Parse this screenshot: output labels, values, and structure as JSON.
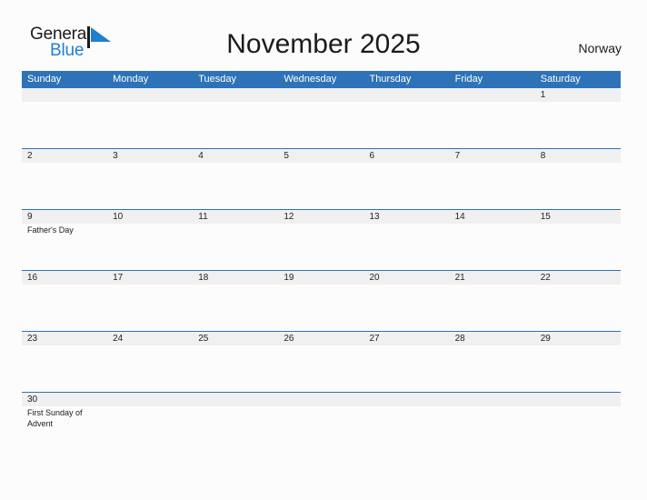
{
  "brand": {
    "name_part1": "General",
    "name_part2": "Blue",
    "logo_icon": "sail-triangle-icon",
    "accent_color": "#1f7fd0"
  },
  "header": {
    "title": "November 2025",
    "country": "Norway"
  },
  "theme": {
    "header_blue": "#2e72b8",
    "band_gray": "#f0f0f0",
    "page_background": "#fcfcfd",
    "text_color": "#1b1b1b"
  },
  "calendar": {
    "month": "November",
    "year": "2025",
    "weekday_headers": [
      "Sunday",
      "Monday",
      "Tuesday",
      "Wednesday",
      "Thursday",
      "Friday",
      "Saturday"
    ],
    "weeks": [
      {
        "days": [
          {
            "num": "",
            "events": []
          },
          {
            "num": "",
            "events": []
          },
          {
            "num": "",
            "events": []
          },
          {
            "num": "",
            "events": []
          },
          {
            "num": "",
            "events": []
          },
          {
            "num": "",
            "events": []
          },
          {
            "num": "1",
            "events": []
          }
        ]
      },
      {
        "days": [
          {
            "num": "2",
            "events": []
          },
          {
            "num": "3",
            "events": []
          },
          {
            "num": "4",
            "events": []
          },
          {
            "num": "5",
            "events": []
          },
          {
            "num": "6",
            "events": []
          },
          {
            "num": "7",
            "events": []
          },
          {
            "num": "8",
            "events": []
          }
        ]
      },
      {
        "days": [
          {
            "num": "9",
            "events": [
              "Father's Day"
            ]
          },
          {
            "num": "10",
            "events": []
          },
          {
            "num": "11",
            "events": []
          },
          {
            "num": "12",
            "events": []
          },
          {
            "num": "13",
            "events": []
          },
          {
            "num": "14",
            "events": []
          },
          {
            "num": "15",
            "events": []
          }
        ]
      },
      {
        "days": [
          {
            "num": "16",
            "events": []
          },
          {
            "num": "17",
            "events": []
          },
          {
            "num": "18",
            "events": []
          },
          {
            "num": "19",
            "events": []
          },
          {
            "num": "20",
            "events": []
          },
          {
            "num": "21",
            "events": []
          },
          {
            "num": "22",
            "events": []
          }
        ]
      },
      {
        "days": [
          {
            "num": "23",
            "events": []
          },
          {
            "num": "24",
            "events": []
          },
          {
            "num": "25",
            "events": []
          },
          {
            "num": "26",
            "events": []
          },
          {
            "num": "27",
            "events": []
          },
          {
            "num": "28",
            "events": []
          },
          {
            "num": "29",
            "events": []
          }
        ]
      },
      {
        "days": [
          {
            "num": "30",
            "events": [
              "First Sunday of Advent"
            ]
          },
          {
            "num": "",
            "events": []
          },
          {
            "num": "",
            "events": []
          },
          {
            "num": "",
            "events": []
          },
          {
            "num": "",
            "events": []
          },
          {
            "num": "",
            "events": []
          },
          {
            "num": "",
            "events": []
          }
        ]
      }
    ]
  }
}
